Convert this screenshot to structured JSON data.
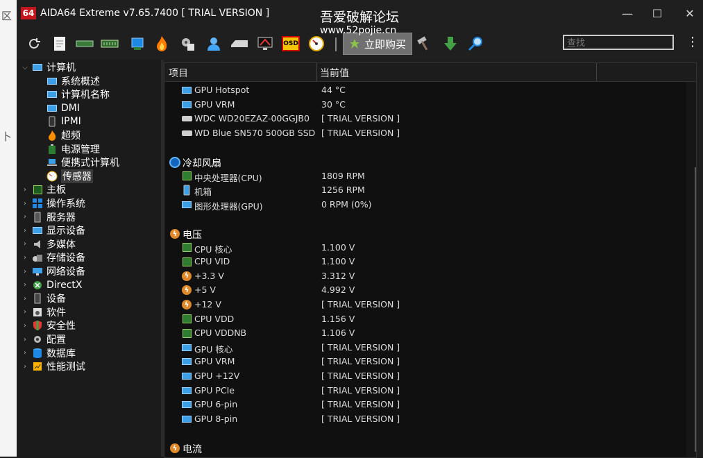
{
  "window": {
    "app_icon": "64",
    "title": "AIDA64 Extreme v7.65.7400  [ TRIAL VERSION ]",
    "watermark_line1": "吾爱破解论坛",
    "watermark_line2": "www.52pojie.cn",
    "minimize": "—",
    "maximize": "☐",
    "close": "✕"
  },
  "background": {
    "chars": [
      "区",
      "卜",
      "",
      "",
      ""
    ]
  },
  "toolbar": {
    "buy_label": "立即购买",
    "search_placeholder": "查找",
    "more": "⋮",
    "osd": "OSD"
  },
  "tree": [
    {
      "label": "计算机",
      "arrow": "⌵",
      "icon": "computer-icon",
      "level": 0
    },
    {
      "label": "系统概述",
      "icon": "monitor-icon",
      "level": 1
    },
    {
      "label": "计算机名称",
      "icon": "monitor-icon",
      "level": 1
    },
    {
      "label": "DMI",
      "icon": "monitor-icon",
      "level": 1
    },
    {
      "label": "IPMI",
      "icon": "phone-icon",
      "level": 1
    },
    {
      "label": "超频",
      "icon": "flame-icon",
      "level": 1
    },
    {
      "label": "电源管理",
      "icon": "battery-icon",
      "level": 1
    },
    {
      "label": "便携式计算机",
      "icon": "laptop-icon",
      "level": 1
    },
    {
      "label": "传感器",
      "icon": "gauge-icon",
      "level": 1,
      "selected": true
    },
    {
      "label": "主板",
      "arrow": "›",
      "icon": "board-icon",
      "level": 0
    },
    {
      "label": "操作系统",
      "arrow": "›",
      "icon": "windows-icon",
      "level": 0
    },
    {
      "label": "服务器",
      "arrow": "›",
      "icon": "server-icon",
      "level": 0
    },
    {
      "label": "显示设备",
      "arrow": "›",
      "icon": "display-icon",
      "level": 0
    },
    {
      "label": "多媒体",
      "arrow": "›",
      "icon": "speaker-icon",
      "level": 0
    },
    {
      "label": "存储设备",
      "arrow": "›",
      "icon": "storage-icon",
      "level": 0
    },
    {
      "label": "网络设备",
      "arrow": "›",
      "icon": "network-icon",
      "level": 0
    },
    {
      "label": "DirectX",
      "arrow": "›",
      "icon": "xbox-icon",
      "level": 0
    },
    {
      "label": "设备",
      "arrow": "›",
      "icon": "device-icon",
      "level": 0
    },
    {
      "label": "软件",
      "arrow": "›",
      "icon": "software-icon",
      "level": 0
    },
    {
      "label": "安全性",
      "arrow": "›",
      "icon": "shield-icon",
      "level": 0
    },
    {
      "label": "配置",
      "arrow": "›",
      "icon": "config-icon",
      "level": 0
    },
    {
      "label": "数据库",
      "arrow": "›",
      "icon": "database-icon",
      "level": 0
    },
    {
      "label": "性能测试",
      "arrow": "›",
      "icon": "benchmark-icon",
      "level": 0
    }
  ],
  "table": {
    "col_item": "项目",
    "col_value": "当前值",
    "rows": [
      {
        "type": "row",
        "icon": "mon",
        "key": "GPU Hotspot",
        "value": "44 °C"
      },
      {
        "type": "row",
        "icon": "mon",
        "key": "GPU VRM",
        "value": "30 °C"
      },
      {
        "type": "row",
        "icon": "disk",
        "key": "WDC WD20EZAZ-00GGJB0",
        "value": "[ TRIAL VERSION ]"
      },
      {
        "type": "row",
        "icon": "disk",
        "key": "WD Blue SN570 500GB SSD",
        "value": "[ TRIAL VERSION ]"
      },
      {
        "type": "gap"
      },
      {
        "type": "group",
        "icon": "fan",
        "key": "冷却风扇"
      },
      {
        "type": "row",
        "icon": "chip",
        "key": "中央处理器(CPU)",
        "value": "1809 RPM"
      },
      {
        "type": "row",
        "icon": "phone",
        "key": "机箱",
        "value": "1256 RPM"
      },
      {
        "type": "row",
        "icon": "mon",
        "key": "图形处理器(GPU)",
        "value": "0 RPM  (0%)"
      },
      {
        "type": "gap"
      },
      {
        "type": "group",
        "icon": "volt",
        "key": "电压"
      },
      {
        "type": "row",
        "icon": "chip",
        "key": "CPU 核心",
        "value": "1.100 V"
      },
      {
        "type": "row",
        "icon": "chip",
        "key": "CPU VID",
        "value": "1.100 V"
      },
      {
        "type": "row",
        "icon": "volt",
        "key": "+3.3 V",
        "value": "3.312 V"
      },
      {
        "type": "row",
        "icon": "volt",
        "key": "+5 V",
        "value": "4.992 V"
      },
      {
        "type": "row",
        "icon": "volt",
        "key": "+12 V",
        "value": "[ TRIAL VERSION ]"
      },
      {
        "type": "row",
        "icon": "chip",
        "key": "CPU VDD",
        "value": "1.156 V"
      },
      {
        "type": "row",
        "icon": "chip",
        "key": "CPU VDDNB",
        "value": "1.106 V"
      },
      {
        "type": "row",
        "icon": "mon",
        "key": "GPU 核心",
        "value": "[ TRIAL VERSION ]"
      },
      {
        "type": "row",
        "icon": "mon",
        "key": "GPU VRM",
        "value": "[ TRIAL VERSION ]"
      },
      {
        "type": "row",
        "icon": "mon",
        "key": "GPU +12V",
        "value": "[ TRIAL VERSION ]"
      },
      {
        "type": "row",
        "icon": "mon",
        "key": "GPU PCIe",
        "value": "[ TRIAL VERSION ]"
      },
      {
        "type": "row",
        "icon": "mon",
        "key": "GPU 6-pin",
        "value": "[ TRIAL VERSION ]"
      },
      {
        "type": "row",
        "icon": "mon",
        "key": "GPU 8-pin",
        "value": "[ TRIAL VERSION ]"
      },
      {
        "type": "gap"
      },
      {
        "type": "group",
        "icon": "volt",
        "key": "电流"
      }
    ]
  }
}
